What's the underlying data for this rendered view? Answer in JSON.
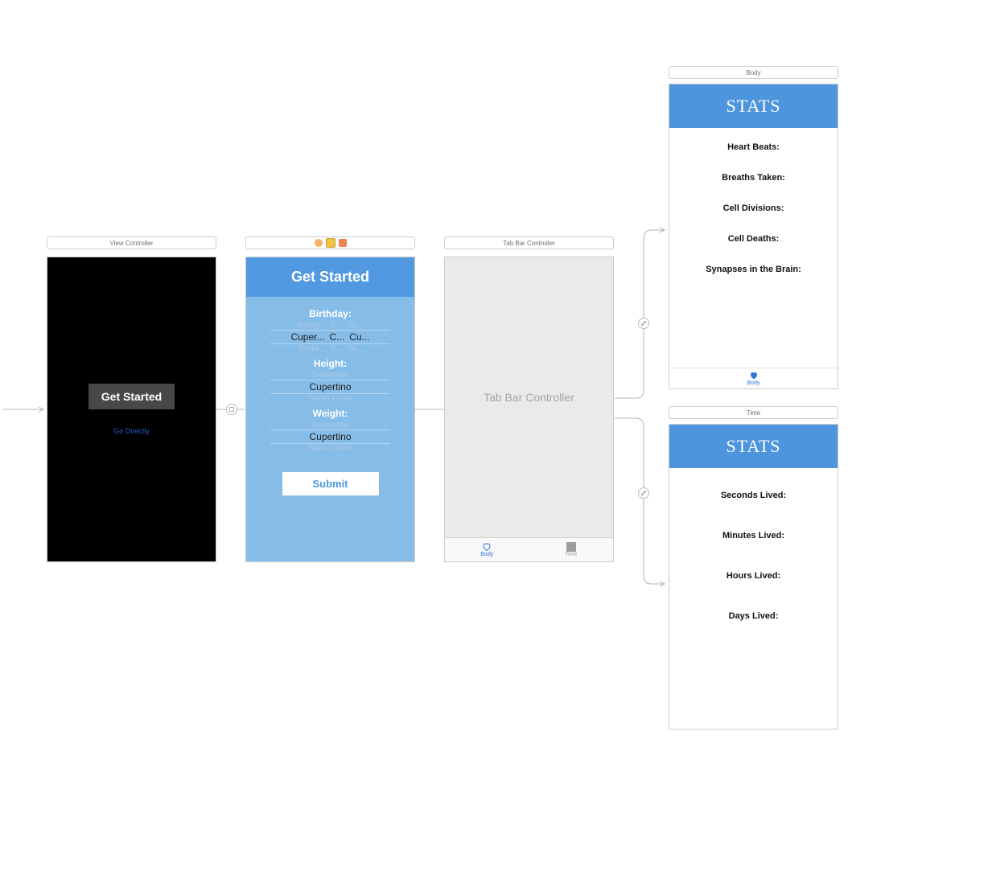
{
  "screen1": {
    "title": "View Controller",
    "button": "Get Started",
    "link": "Go Directly"
  },
  "screen2": {
    "header": "Get Started",
    "birthday_label": "Birthday:",
    "height_label": "Height:",
    "weight_label": "Weight:",
    "picker_faded_top_a": "Sunny...",
    "picker_faded_top_b": "S...",
    "picker_faded_top_c": "Su...",
    "picker_main_a": "Cuper...",
    "picker_main_b": "C...",
    "picker_main_c": "Cu...",
    "picker_faded_bot_a": "Santa...",
    "picker_faded_bot_b": "S...",
    "picker_faded_bot_c": "Sa...",
    "picker_single_top": "Sunnyvale",
    "picker_single_main": "Cupertino",
    "picker_single_bot": "Santa Clara",
    "submit": "Submit"
  },
  "screen3": {
    "title": "Tab Bar Controller",
    "placeholder": "Tab Bar Controller",
    "tab_body": "Body",
    "tab_time": "Time"
  },
  "screen4": {
    "title": "Body",
    "header": "STATS",
    "rows": {
      "r0": "Heart Beats:",
      "r1": "Breaths Taken:",
      "r2": "Cell Divisions:",
      "r3": "Cell Deaths:",
      "r4": "Synapses in the Brain:"
    },
    "tab": "Body"
  },
  "screen5": {
    "title": "Time",
    "header": "STATS",
    "rows": {
      "r0": "Seconds Lived:",
      "r1": "Minutes Lived:",
      "r2": "Hours Lived:",
      "r3": "Days Lived:"
    }
  }
}
